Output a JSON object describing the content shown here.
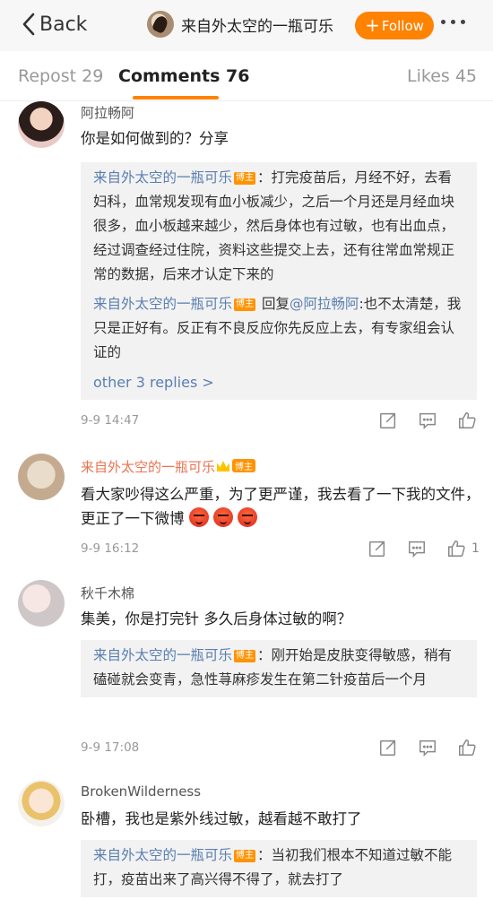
{
  "header": {
    "back_label": "Back",
    "title": "来自外太空的一瓶可乐",
    "follow_label": "Follow"
  },
  "tabs": {
    "repost": "Repost 29",
    "comments": "Comments 76",
    "likes": "Likes 45"
  },
  "comments": [
    {
      "name": "阿拉畅阿",
      "text": "你是如何做到的？分享",
      "replies": [
        {
          "name": "来自外太空的一瓶可乐",
          "badge": "博主",
          "text": "：打完疫苗后，月经不好，去看妇科，血常规发现有血小板减少，之后一个月还是月经血块很多，血小板越来越少，然后身体也有过敏，也有出血点，经过调查经过住院，资料这些提交上去，还有往常血常规正常的数据，后来才认定下来的"
        },
        {
          "name": "来自外太空的一瓶可乐",
          "badge": "博主",
          "prefix": " 回复",
          "mention": "@阿拉畅阿",
          "text": ":也不太清楚，我只是正好有。反正有不良反应你先反应上去，有专家组会认证的"
        }
      ],
      "more_replies": "other 3 replies >",
      "time": "9-9 14:47",
      "likes": ""
    },
    {
      "name": "来自外太空的一瓶可乐",
      "badge": "博主",
      "text": "看大家吵得这么严重，为了更严谨，我去看了一下我的文件，更正了一下微博",
      "time": "9-9 16:12",
      "likes": "1"
    },
    {
      "name": "秋千木棉",
      "text": "集美，你是打完针  多久后身体过敏的啊？",
      "replies": [
        {
          "name": "来自外太空的一瓶可乐",
          "badge": "博主",
          "text": "：刚开始是皮肤变得敏感，稍有磕碰就会变青，急性荨麻疹发生在第二针疫苗后一个月"
        }
      ],
      "time": "9-9 17:08",
      "likes": ""
    },
    {
      "name": "BrokenWilderness",
      "text": "卧槽，我也是紫外线过敏，越看越不敢打了",
      "replies": [
        {
          "name": "来自外太空的一瓶可乐",
          "badge": "博主",
          "text": "：当初我们根本不知道过敏不能打，疫苗出来了高兴得不得了，就去打了"
        }
      ]
    }
  ],
  "colors": {
    "accent": "#ff8200",
    "link": "#5a7fb0",
    "username": "#eb7350"
  }
}
